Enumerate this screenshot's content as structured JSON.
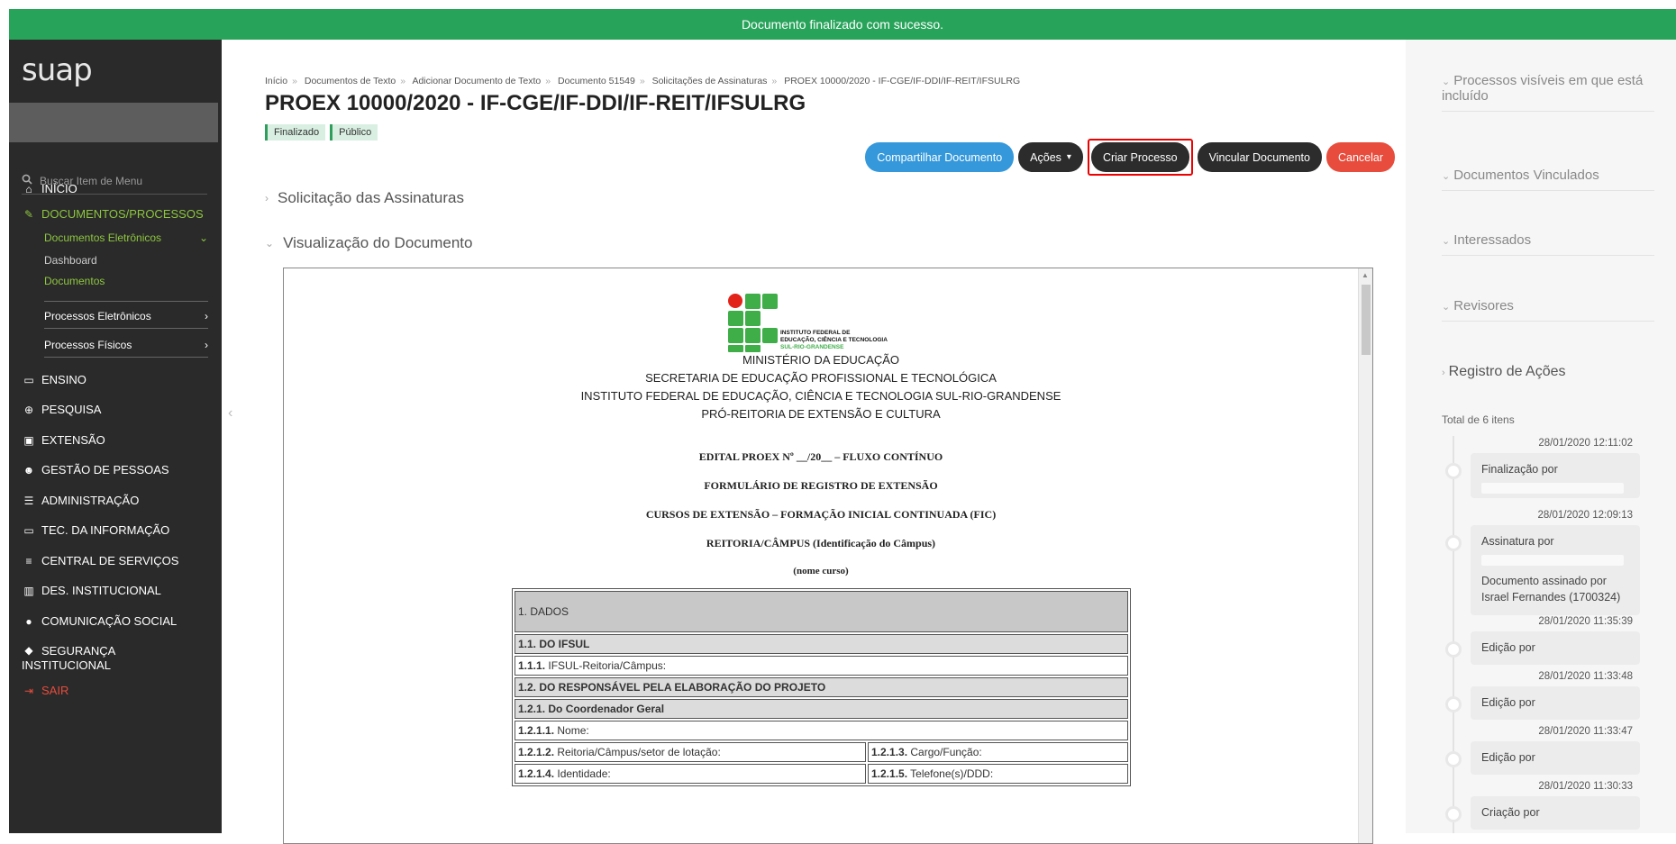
{
  "notification": "Documento finalizado com sucesso.",
  "sidebar": {
    "logo": "suap",
    "search_placeholder": "Buscar Item de Menu",
    "menu": {
      "inicio": "INÍCIO",
      "documentos_processos": "DOCUMENTOS/PROCESSOS",
      "documentos_eletronicos": "Documentos Eletrônicos",
      "dashboard": "Dashboard",
      "documentos": "Documentos",
      "processos_eletronicos": "Processos Eletrônicos",
      "processos_fisicos": "Processos Físicos",
      "ensino": "ENSINO",
      "pesquisa": "PESQUISA",
      "extensao": "EXTENSÃO",
      "gestao_pessoas": "GESTÃO DE PESSOAS",
      "administracao": "ADMINISTRAÇÃO",
      "tec_informacao": "TEC. DA INFORMAÇÃO",
      "central_servicos": "CENTRAL DE SERVIÇOS",
      "des_institucional": "DES. INSTITUCIONAL",
      "comunicacao_social": "COMUNICAÇÃO SOCIAL",
      "seguranca_1": "SEGURANÇA",
      "seguranca_2": "INSTITUCIONAL",
      "sair": "SAIR"
    }
  },
  "breadcrumb": [
    "Início",
    "Documentos de Texto",
    "Adicionar Documento de Texto",
    "Documento 51549",
    "Solicitações de Assinaturas",
    "PROEX 10000/2020 - IF-CGE/IF-DDI/IF-REIT/IFSULRG"
  ],
  "page_title": "PROEX 10000/2020 - IF-CGE/IF-DDI/IF-REIT/IFSULRG",
  "tags": [
    "Finalizado",
    "Público"
  ],
  "actions": {
    "compartilhar": "Compartilhar Documento",
    "acoes": "Ações",
    "criar_processo": "Criar Processo",
    "vincular": "Vincular Documento",
    "cancelar": "Cancelar"
  },
  "sections": {
    "solicitacao": "Solicitação das Assinaturas",
    "visualizacao": "Visualização do Documento"
  },
  "document": {
    "logo_text_1": "INSTITUTO FEDERAL DE",
    "logo_text_2": "EDUCAÇÃO, CIÊNCIA E TECNOLOGIA",
    "logo_text_3": "SUL-RIO-GRANDENSE",
    "header_1": "MINISTÉRIO DA EDUCAÇÃO",
    "header_2": "SECRETARIA DE EDUCAÇÃO PROFISSIONAL E TECNOLÓGICA",
    "header_3": "INSTITUTO FEDERAL DE EDUCAÇÃO, CIÊNCIA E TECNOLOGIA SUL-RIO-GRANDENSE",
    "header_4": "PRÓ-REITORIA DE EXTENSÃO E CULTURA",
    "edital": "EDITAL PROEX Nº __/20__ – FLUXO CONTÍNUO",
    "formulario": "FORMULÁRIO DE REGISTRO DE EXTENSÃO",
    "cursos": "CURSOS DE EXTENSÃO – FORMAÇÃO INICIAL CONTINUADA (FIC)",
    "reitoria": "REITORIA/CÂMPUS (Identificação do Câmpus)",
    "nome_curso": "(nome curso)",
    "table": {
      "r1": "1. DADOS",
      "r2": "1.1. DO IFSUL",
      "r3_num": "1.1.1.",
      "r3_text": " IFSUL-Reitoria/Câmpus:",
      "r4": "1.2. DO RESPONSÁVEL PELA ELABORAÇÃO DO PROJETO",
      "r5": "1.2.1. Do Coordenador Geral",
      "r6_num": "1.2.1.1.",
      "r6_text": " Nome:",
      "r7a_num": "1.2.1.2.",
      "r7a_text": " Reitoria/Câmpus/setor de lotação:",
      "r7b_num": "1.2.1.3.",
      "r7b_text": " Cargo/Função:",
      "r8a_num": "1.2.1.4.",
      "r8a_text": " Identidade:",
      "r8b_num": "1.2.1.5.",
      "r8b_text": " Telefone(s)/DDD:"
    }
  },
  "right_panel": {
    "processos_visiveis": "Processos visíveis em que está incluído",
    "docs_vinculados": "Documentos Vinculados",
    "interessados": "Interessados",
    "revisores": "Revisores",
    "registro": "Registro de Ações",
    "total": "Total de 6 itens",
    "timeline": [
      {
        "time": "28/01/2020 12:11:02",
        "action": "Finalização por"
      },
      {
        "time": "28/01/2020 12:09:13",
        "action": "Assinatura por",
        "detail": "Documento assinado por Israel Fernandes (1700324)"
      },
      {
        "time": "28/01/2020 11:35:39",
        "action": "Edição por"
      },
      {
        "time": "28/01/2020 11:33:48",
        "action": "Edição por"
      },
      {
        "time": "28/01/2020 11:33:47",
        "action": "Edição por"
      },
      {
        "time": "28/01/2020 11:30:33",
        "action": "Criação por"
      }
    ]
  },
  "colors": {
    "success": "#27a35a",
    "sidebar": "#2a2a2a",
    "active_green": "#8dc63f",
    "primary": "#3498db",
    "danger": "#e74c3c"
  },
  "icons": [
    "search-icon",
    "home-icon",
    "document-icon",
    "chevron-down-icon",
    "chevron-right-icon",
    "teaching-icon",
    "globe-icon",
    "briefcase-icon",
    "people-icon",
    "list-icon",
    "laptop-icon",
    "menu-icon",
    "chart-icon",
    "chat-icon",
    "shield-icon",
    "logout-icon"
  ]
}
